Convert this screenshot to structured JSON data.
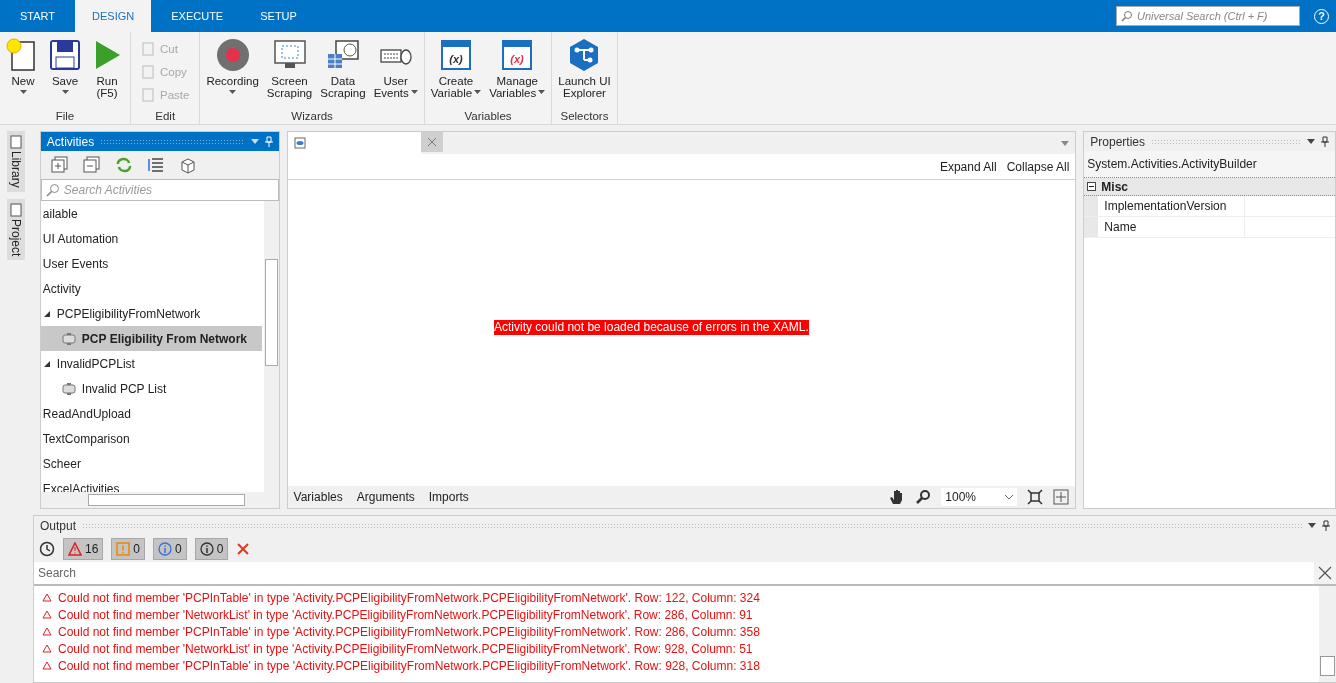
{
  "top_tabs": [
    {
      "label": "START",
      "selected": false
    },
    {
      "label": "DESIGN",
      "selected": true
    },
    {
      "label": "EXECUTE",
      "selected": false
    },
    {
      "label": "SETUP",
      "selected": false
    }
  ],
  "universal_search": {
    "placeholder": "Universal Search (Ctrl + F)"
  },
  "help": "?",
  "ribbon": [
    {
      "label": "File",
      "buttons": [
        {
          "kind": "large",
          "lines": [
            "New"
          ],
          "dropdown": true,
          "disabled": false
        },
        {
          "kind": "large",
          "lines": [
            "Save"
          ],
          "dropdown": true,
          "disabled": false
        },
        {
          "kind": "large",
          "lines": [
            "Run",
            "(F5)"
          ],
          "dropdown": false,
          "disabled": false
        }
      ]
    },
    {
      "label": "Edit",
      "buttons": [
        {
          "kind": "small",
          "lines": [
            "Cut"
          ],
          "disabled": true
        },
        {
          "kind": "small",
          "lines": [
            "Copy"
          ],
          "disabled": true
        },
        {
          "kind": "small",
          "lines": [
            "Paste"
          ],
          "disabled": true
        }
      ]
    },
    {
      "label": "Wizards",
      "buttons": [
        {
          "kind": "large",
          "lines": [
            "Recording"
          ],
          "dropdown": true,
          "disabled": false
        },
        {
          "kind": "large",
          "lines": [
            "Screen",
            "Scraping"
          ],
          "dropdown": false,
          "disabled": false
        },
        {
          "kind": "large",
          "lines": [
            "Data",
            "Scraping"
          ],
          "dropdown": false,
          "disabled": false
        },
        {
          "kind": "large",
          "lines": [
            "User",
            "Events"
          ],
          "dropdown": true,
          "disabled": false
        }
      ]
    },
    {
      "label": "Variables",
      "buttons": [
        {
          "kind": "large",
          "lines": [
            "Create",
            "Variable"
          ],
          "icon_glyph": "(x)",
          "dropdown": true,
          "disabled": false
        },
        {
          "kind": "large",
          "lines": [
            "Manage",
            "Variables"
          ],
          "icon_glyph": "(x)",
          "dropdown": true,
          "disabled": false
        }
      ]
    },
    {
      "label": "Selectors",
      "buttons": [
        {
          "kind": "large",
          "lines": [
            "Launch UI",
            "Explorer"
          ],
          "dropdown": false,
          "disabled": false
        }
      ]
    }
  ],
  "side_tabs": [
    "Library",
    "Project"
  ],
  "activities": {
    "title": "Activities",
    "search": {
      "placeholder": "Search Activities"
    },
    "tree": [
      {
        "label": "ailable"
      },
      {
        "label": "UI Automation"
      },
      {
        "label": "User Events"
      },
      {
        "label": "Activity",
        "children": [
          {
            "label": "PCPEligibilityFromNetwork",
            "expanded": true,
            "children": [
              {
                "label": "PCP Eligibility From Network",
                "selected": true
              }
            ]
          },
          {
            "label": "InvalidPCPList",
            "expanded": true,
            "children": [
              {
                "label": "Invalid PCP List",
                "selected": false
              }
            ]
          }
        ]
      },
      {
        "label": "ReadAndUpload"
      },
      {
        "label": "TextComparison"
      },
      {
        "label": "Scheer"
      },
      {
        "label": "ExcelActivities"
      }
    ]
  },
  "designer": {
    "expand_all": "Expand All",
    "collapse_all": "Collapse All",
    "error": "Activity could not be loaded because of errors in the XAML.",
    "bottom_tabs": [
      "Variables",
      "Arguments",
      "Imports"
    ],
    "zoom": "100%"
  },
  "properties": {
    "title": "Properties",
    "object": "System.Activities.ActivityBuilder",
    "categories": [
      {
        "label": "Misc",
        "expanded": true,
        "items": [
          "ImplementationVersion",
          "Name"
        ]
      }
    ]
  },
  "output": {
    "title": "Output",
    "filters": [
      {
        "kind": "error",
        "count": "16",
        "selected": true
      },
      {
        "kind": "warning",
        "count": "0",
        "selected": true
      },
      {
        "kind": "info",
        "count": "0",
        "selected": true
      },
      {
        "kind": "trace",
        "count": "0",
        "selected": true
      }
    ],
    "search": {
      "placeholder": "Search"
    },
    "messages": [
      "Could not find member 'PCPInTable' in type 'Activity.PCPEligibilityFromNetwork.PCPEligibilityFromNetwork'. Row: 122, Column: 324",
      "Could not find member 'NetworkList' in type 'Activity.PCPEligibilityFromNetwork.PCPEligibilityFromNetwork'. Row: 286, Column: 91",
      "Could not find member 'PCPInTable' in type 'Activity.PCPEligibilityFromNetwork.PCPEligibilityFromNetwork'. Row: 286, Column: 358",
      "Could not find member 'NetworkList' in type 'Activity.PCPEligibilityFromNetwork.PCPEligibilityFromNetwork'. Row: 928, Column: 51",
      "Could not find member 'PCPInTable' in type 'Activity.PCPEligibilityFromNetwork.PCPEligibilityFromNetwork'. Row: 928, Column: 318"
    ]
  }
}
